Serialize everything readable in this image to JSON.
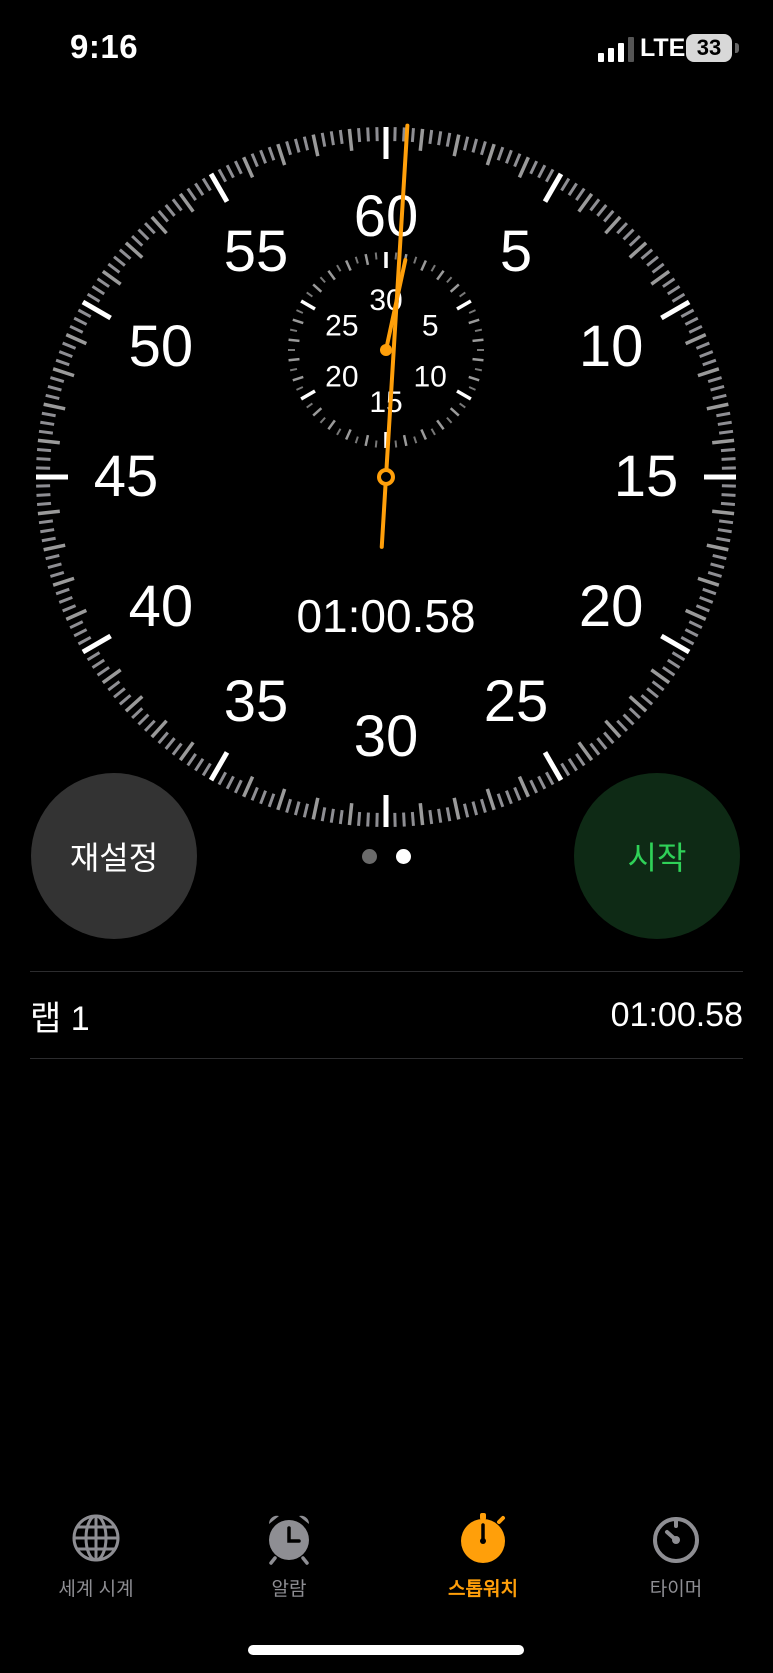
{
  "status": {
    "time": "9:16",
    "network": "LTE",
    "battery": "33"
  },
  "stopwatch": {
    "elapsed": "01:00.58",
    "seconds_dial_labels": [
      "60",
      "5",
      "10",
      "15",
      "20",
      "25",
      "30",
      "35",
      "40",
      "45",
      "50",
      "55"
    ],
    "minutes_dial_labels": [
      "30",
      "5",
      "10",
      "15",
      "20",
      "25"
    ],
    "seconds_hand_value": 0.58,
    "minutes_hand_value": 1.01
  },
  "buttons": {
    "reset": "재설정",
    "start": "시작"
  },
  "pages": {
    "count": 2,
    "active": 2
  },
  "laps": [
    {
      "label": "랩 1",
      "time": "01:00.58"
    }
  ],
  "tabs": [
    {
      "label": "세계 시계",
      "icon": "globe-icon"
    },
    {
      "label": "알람",
      "icon": "alarm-clock-icon"
    },
    {
      "label": "스톱워치",
      "icon": "stopwatch-icon",
      "active": true
    },
    {
      "label": "타이머",
      "icon": "timer-icon"
    }
  ],
  "colors": {
    "accent": "#ff9f0a",
    "start_text": "#2fd158",
    "start_bg": "#0e2a15",
    "reset_bg": "#333333"
  }
}
